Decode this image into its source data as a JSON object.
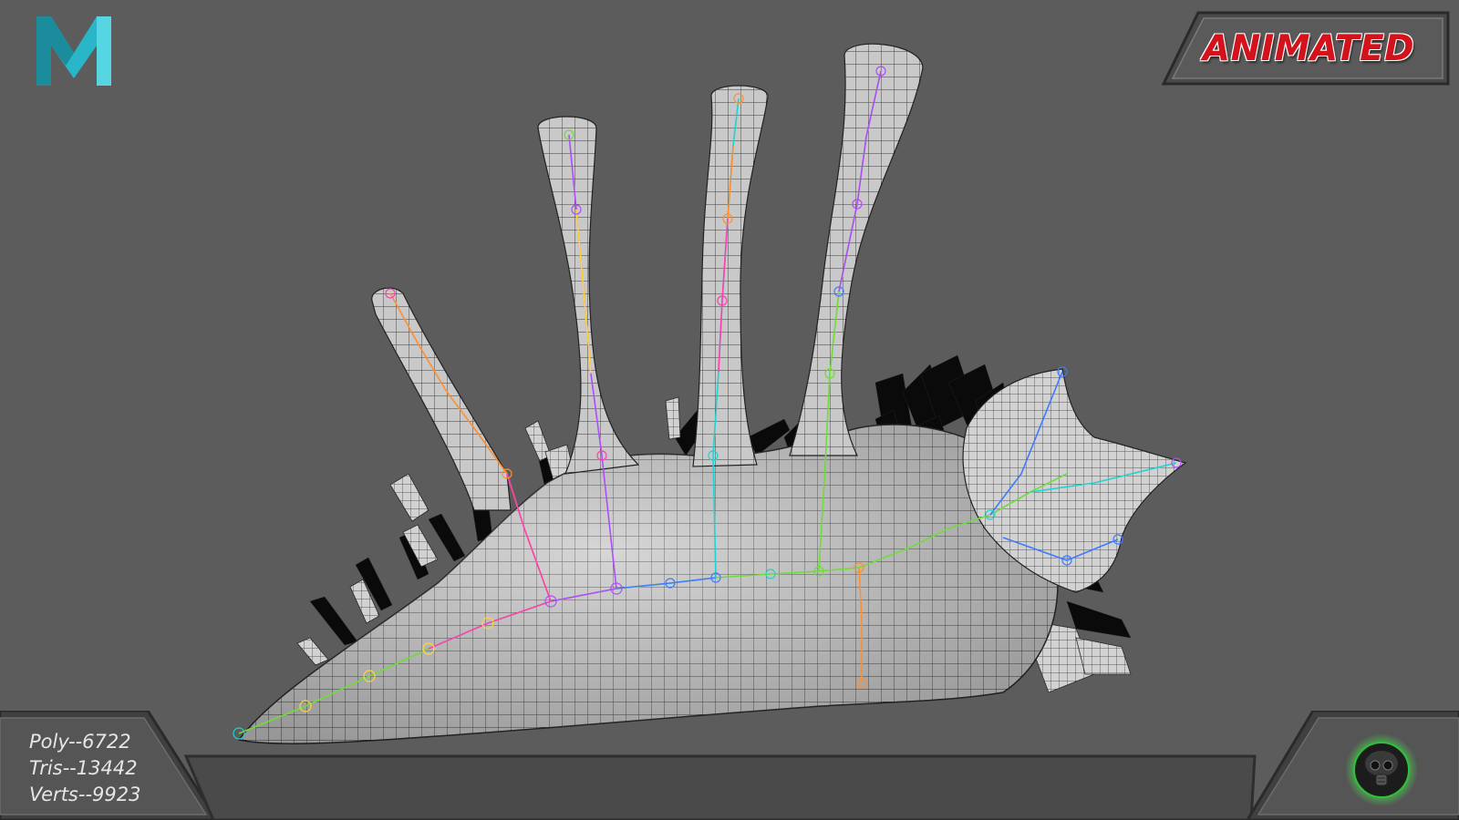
{
  "app": {
    "logo_icon": "maya-m-logo-icon",
    "accent_logo": "#29b6c8",
    "background": "#5c5c5c"
  },
  "badge": {
    "text": "ANIMATED",
    "text_color": "#d4121b"
  },
  "stats": {
    "poly": "Poly--6722",
    "tris": "Tris--13442",
    "verts": "Verts--9923"
  },
  "model": {
    "icon": "wireframe-creature-model",
    "rig_colors": [
      "#ff3fb4",
      "#b04bff",
      "#3f7bff",
      "#1fd2d2",
      "#6edc3a",
      "#ffd43f",
      "#ff8f2e"
    ]
  },
  "studio": {
    "icon": "gas-mask-glow-icon",
    "glow_color": "#3fe84a"
  }
}
